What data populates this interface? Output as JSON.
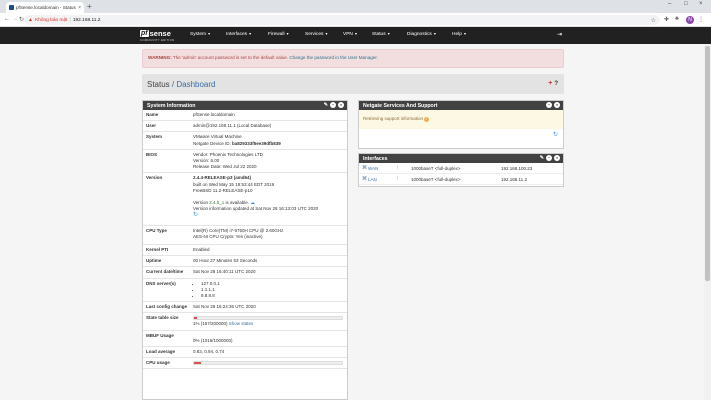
{
  "browser": {
    "tab_title": "pfSense.localdomain - Status: D...",
    "close": "×",
    "new_tab": "+",
    "not_secure": "Không bảo mật",
    "url": "192.168.11.2",
    "star": "☆",
    "avatar_letter": "N",
    "win_min": "–",
    "win_max": "□",
    "win_close": "×"
  },
  "nav": {
    "logo_pf": "pf",
    "logo_sense": "sense",
    "logo_sub": "COMMUNITY EDITION",
    "menus": [
      "System",
      "Interfaces",
      "Firewall",
      "Services",
      "VPN",
      "Status",
      "Diagnostics",
      "Help"
    ]
  },
  "warning": {
    "strong": "WARNING:",
    "text": " The 'admin' account password is set to the default value. ",
    "link": "Change the password in the User Manager."
  },
  "breadcrumb": {
    "status": "Status",
    "slash": " / ",
    "page": "Dashboard",
    "add": "+",
    "help": "?"
  },
  "sysinfo": {
    "title": "System Information",
    "name_k": "Name",
    "name_v": "pfSense.localdomain",
    "user_k": "User",
    "user_v": "admin@192.168.11.1 (Local Database)",
    "system_k": "System",
    "system_v1": "VMware Virtual Machine",
    "system_v2_label": "Netgate Device ID: ",
    "system_v2_id": "ba829333f5ee39dfb839",
    "bios_k": "BIOS",
    "bios_v1": "Vendor: Phoenix Technologies LTD",
    "bios_v2": "Version: 6.00",
    "bios_v3": "Release Date: Wed Jul 22 2020",
    "version_k": "Version",
    "version_v1": "2.4.4-RELEASE-p3 (amd64)",
    "version_v2": "built on Wed May 15 18:53:44 EDT 2019",
    "version_v3": "FreeBSD 11.2-RELEASE-p10",
    "version_avail_pre": "Version ",
    "version_avail_num": "2.4.5_1",
    "version_avail_post": " is available.",
    "version_updated": "Version information updated at Sat Nov 28 16:13:03 UTC 2020",
    "cpu_k": "CPU Type",
    "cpu_v1": "Intel(R) Core(TM) i7-9750H CPU @ 2.60GHz",
    "cpu_v2": "AES-NI CPU Crypto: Yes (inactive)",
    "kpti_k": "Kernel PTI",
    "kpti_v": "Enabled",
    "uptime_k": "Uptime",
    "uptime_v": "00 Hour 27 Minutes 53 Seconds",
    "date_k": "Current date/time",
    "date_v": "Sat Nov 28 16:40:11 UTC 2020",
    "dns_k": "DNS server(s)",
    "dns": [
      "127.0.0.1",
      "1.1.1.1",
      "8.8.8.8"
    ],
    "lastcfg_k": "Last config change",
    "lastcfg_v": "Sat Nov 28 16:24:36 UTC 2020",
    "state_k": "State table size",
    "state_v": "1% (157/200000)",
    "state_link": "Show states",
    "state_fraction": 0.01,
    "mbuf_k": "MBUF Usage",
    "mbuf_v": "0% (1016/1000000)",
    "load_k": "Load average",
    "load_v": "0.83, 0.94, 0.74",
    "cpuuse_k": "CPU usage",
    "cpu_fraction": 0.05
  },
  "netgate": {
    "title": "Netgate Services And Support",
    "body": "Retrieving support information "
  },
  "interfaces": {
    "title": "Interfaces",
    "rows": [
      {
        "name": "WAN",
        "media": "1000baseT <full-duplex>",
        "ip": "192.168.100.23"
      },
      {
        "name": "LAN",
        "media": "1000baseT <full-duplex>",
        "ip": "192.168.11.2"
      }
    ]
  }
}
